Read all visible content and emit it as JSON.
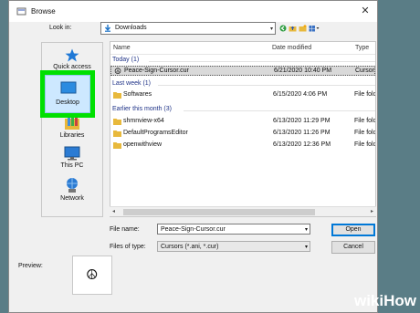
{
  "window": {
    "title": "Browse",
    "close_glyph": "✕"
  },
  "lookin": {
    "label": "Look in:",
    "value": "Downloads",
    "arrow": "▾"
  },
  "toolbar": {
    "back_icon": "back-icon",
    "up_icon": "up-folder-icon",
    "new_folder_icon": "new-folder-icon",
    "view_menu_icon": "view-menu-icon"
  },
  "places": [
    {
      "name": "quick-access",
      "label": "Quick access"
    },
    {
      "name": "desktop",
      "label": "Desktop"
    },
    {
      "name": "libraries",
      "label": "Libraries"
    },
    {
      "name": "this-pc",
      "label": "This PC"
    },
    {
      "name": "network",
      "label": "Network"
    }
  ],
  "columns": {
    "name": "Name",
    "date": "Date modified",
    "type": "Type"
  },
  "groups": [
    {
      "label": "Today (1)",
      "rows": [
        {
          "name": "Peace-Sign-Cursor.cur",
          "date": "6/21/2020 10:40 PM",
          "type": "Cursor",
          "icon": "peace-cursor-icon",
          "selected": true
        }
      ]
    },
    {
      "label": "Last week (1)",
      "rows": [
        {
          "name": "Softwares",
          "date": "6/15/2020 4:06 PM",
          "type": "File folder",
          "icon": "folder-icon",
          "selected": false
        }
      ]
    },
    {
      "label": "Earlier this month (3)",
      "rows": [
        {
          "name": "shmnview-x64",
          "date": "6/13/2020 11:29 PM",
          "type": "File folder",
          "icon": "folder-icon",
          "selected": false
        },
        {
          "name": "DefaultProgramsEditor",
          "date": "6/13/2020 11:26 PM",
          "type": "File folder",
          "icon": "folder-icon",
          "selected": false
        },
        {
          "name": "openwithview",
          "date": "6/13/2020 12:36 PM",
          "type": "File folder",
          "icon": "folder-icon",
          "selected": false
        }
      ]
    }
  ],
  "form": {
    "filename_label": "File name:",
    "filename_value": "Peace-Sign-Cursor.cur",
    "filetype_label": "Files of type:",
    "filetype_value": "Cursors (*.ani, *.cur)",
    "open_label": "Open",
    "cancel_label": "Cancel"
  },
  "preview": {
    "label": "Preview:",
    "glyph": "☮"
  },
  "watermark": {
    "wiki": "wiki",
    "how": "How"
  },
  "colors": {
    "highlight": "#00e000",
    "selection": "#cde8ff",
    "group_text": "#1e3287",
    "folder": "#e8b93c"
  }
}
